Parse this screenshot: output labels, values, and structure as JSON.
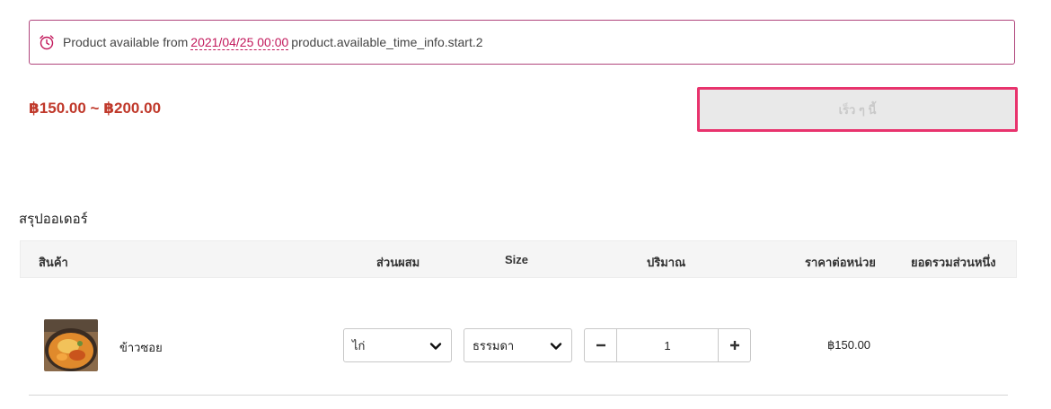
{
  "availability": {
    "prefix": "Product available from",
    "date": "2021/04/25 00:00",
    "suffix": "product.available_time_info.start.2",
    "icon": "alarm-clock-icon"
  },
  "price_range": "฿150.00 ~ ฿200.00",
  "soon_button_label": "เร็ว ๆ นี้",
  "summary": {
    "title": "สรุปออเดอร์",
    "headers": {
      "product": "สินค้า",
      "mix": "ส่วนผสม",
      "size": "Size",
      "quantity": "ปริมาณ",
      "unit_price": "ราคาต่อหน่วย",
      "subtotal": "ยอดรวมส่วนหนึ่ง"
    },
    "rows": [
      {
        "name": "ข้าวซอย",
        "mix": "ไก่",
        "size": "ธรรมดา",
        "quantity": "1",
        "unit_price": "฿150.00"
      }
    ]
  },
  "colors": {
    "accent": "#c2185b",
    "price": "#c0392b",
    "highlight_border": "#e8336d"
  }
}
